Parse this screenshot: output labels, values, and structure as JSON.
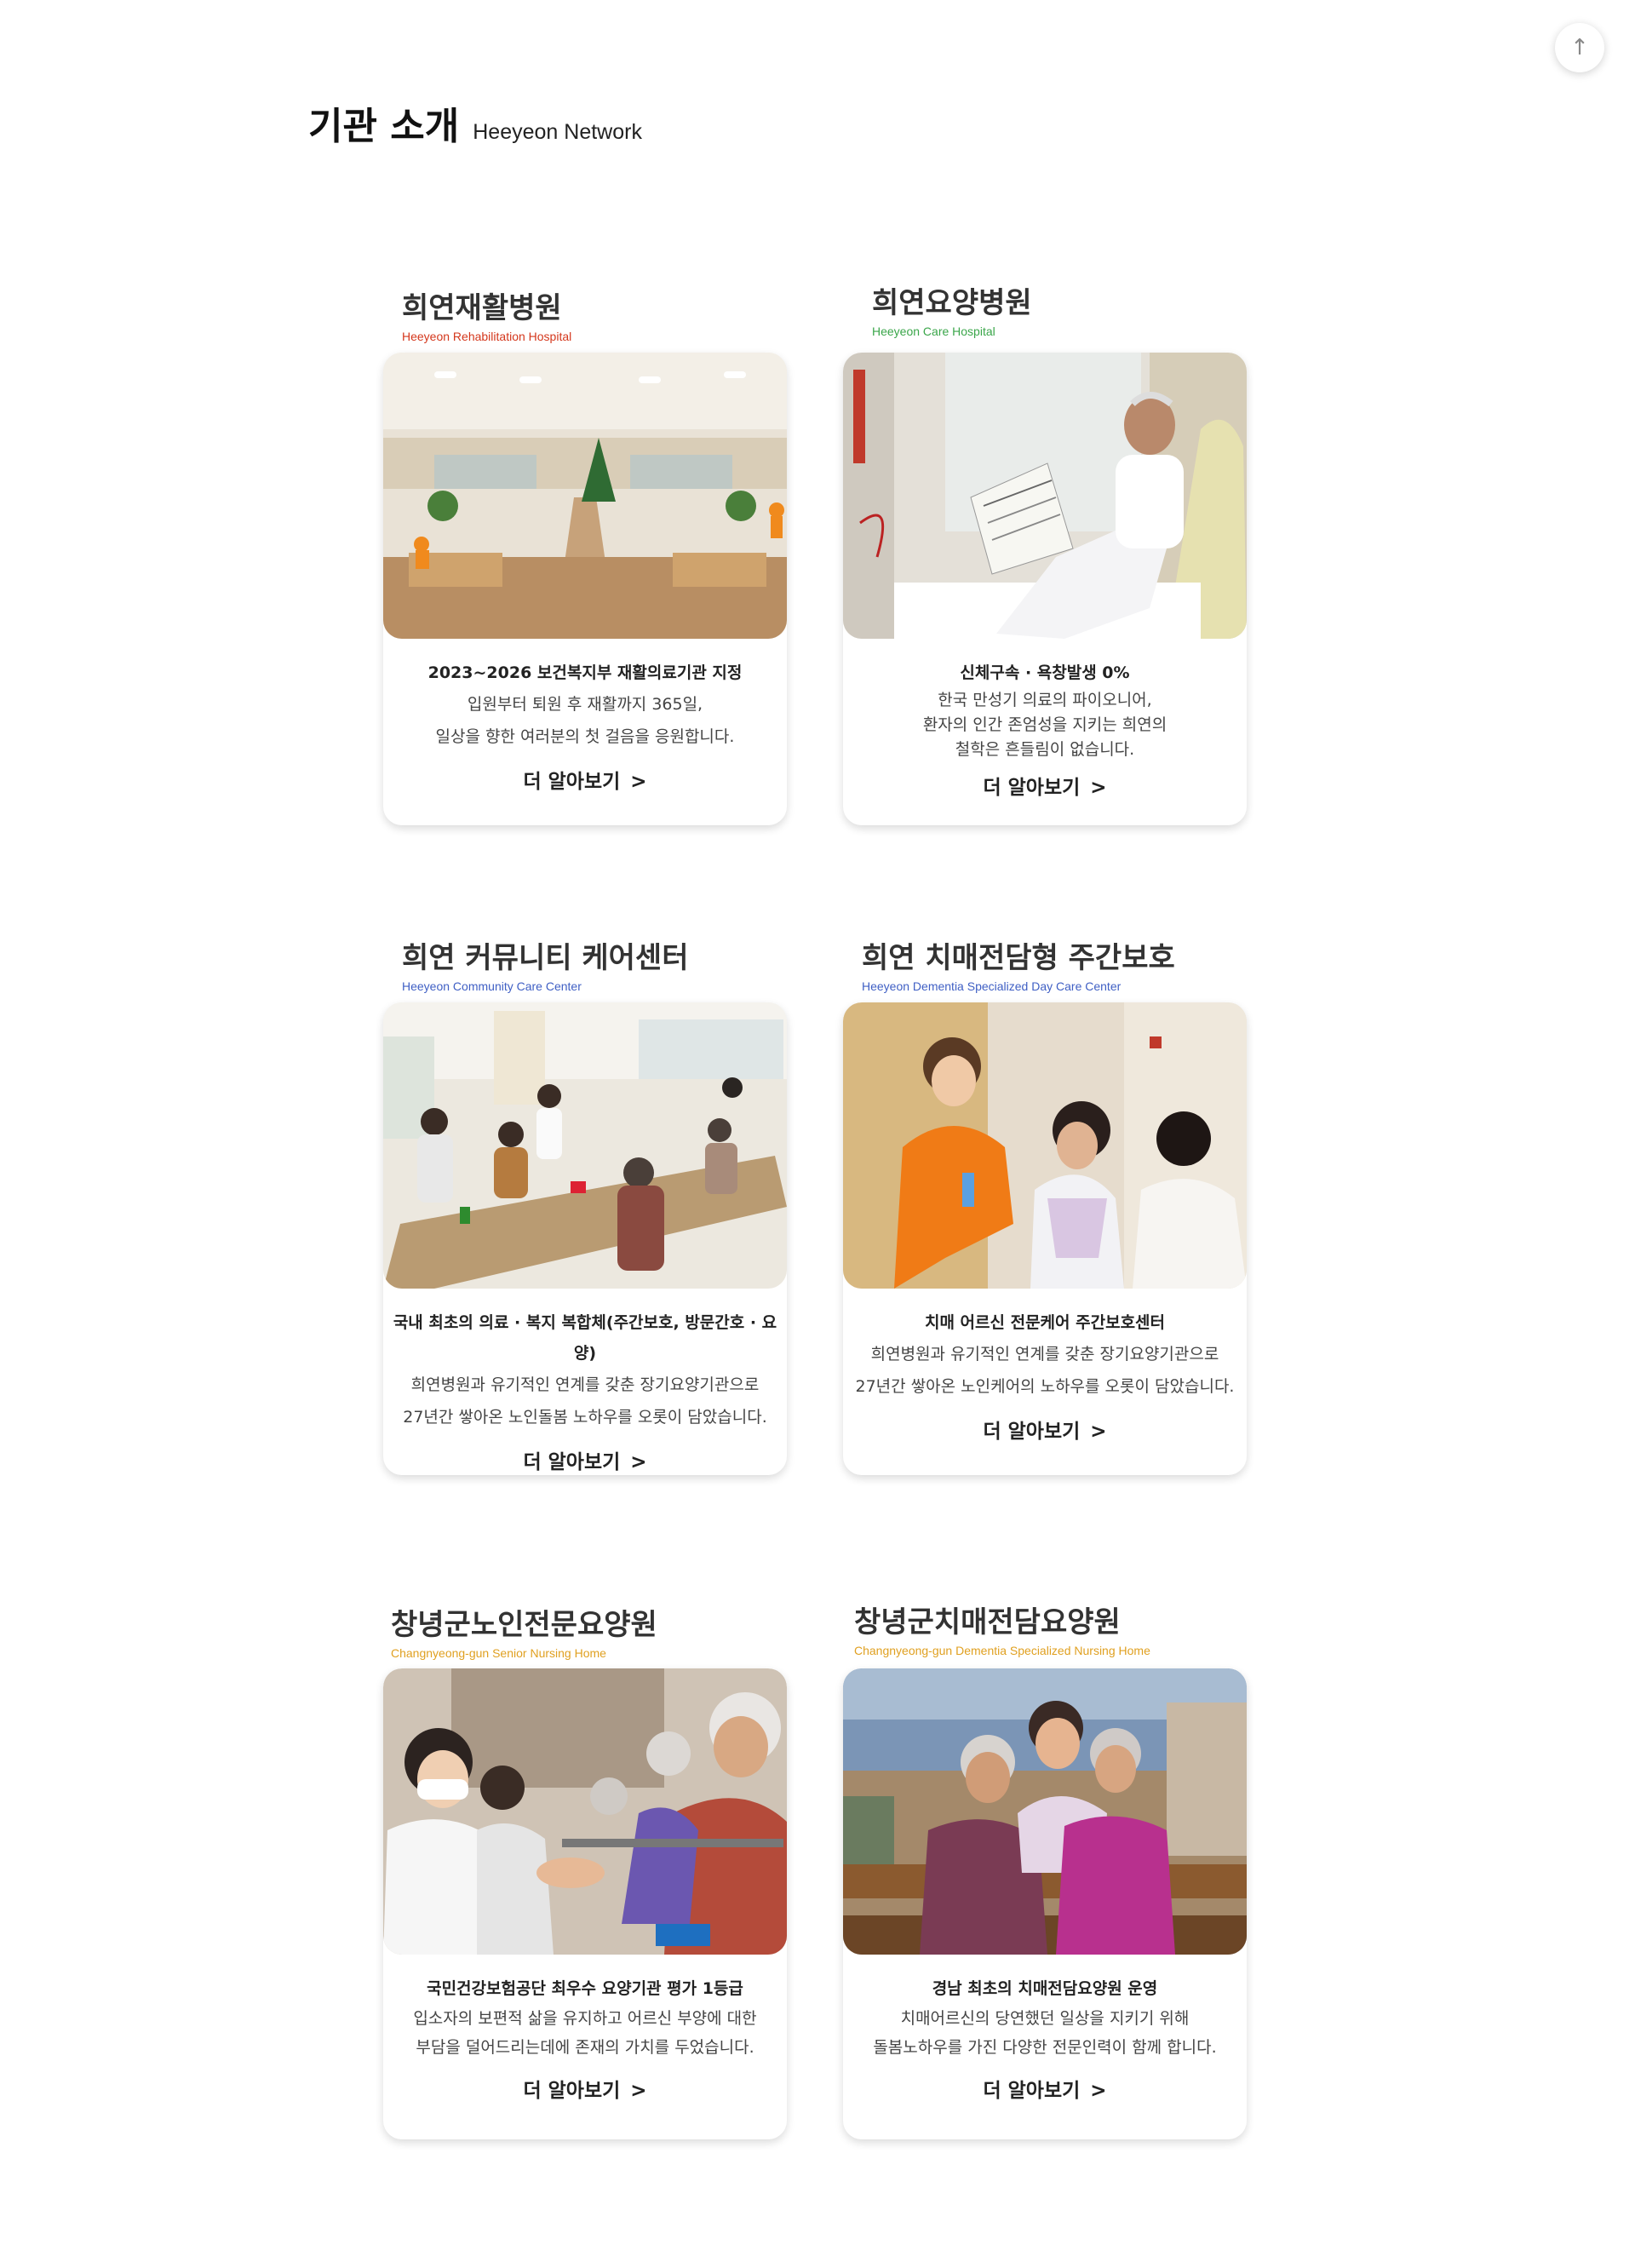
{
  "page": {
    "title_ko": "기관 소개",
    "title_en": "Heeyeon Network",
    "top_button_icon": "arrow-up-icon"
  },
  "institutions": [
    {
      "name_ko": "희연재활병원",
      "name_en": "Heeyeon Rehabilitation Hospital",
      "en_color": "#d4371c",
      "headline": "2023~2026 보건복지부 재활의료기관 지정",
      "lines": [
        "입원부터 퇴원 후 재활까지 365일,",
        "일상을 향한 여러분의 첫 걸음을 응원합니다."
      ],
      "more": "더 알아보기",
      "chev": ">"
    },
    {
      "name_ko": "희연요양병원",
      "name_en": "Heeyeon Care Hospital",
      "en_color": "#3aa64a",
      "headline": "신체구속 · 욕창발생 0%",
      "lines": [
        "한국 만성기 의료의 파이오니어,",
        "환자의 인간 존엄성을 지키는 희연의",
        "철학은 흔들림이 없습니다."
      ],
      "more": "더 알아보기",
      "chev": ">"
    },
    {
      "name_ko": "희연 커뮤니티 케어센터",
      "name_en": "Heeyeon Community Care Center",
      "en_color": "#3f5fc4",
      "headline": "국내 최초의 의료 · 복지 복합체(주간보호, 방문간호 · 요양)",
      "lines": [
        "희연병원과 유기적인 연계를 갖춘 장기요양기관으로",
        "27년간 쌓아온 노인돌봄 노하우를 오롯이 담았습니다."
      ],
      "more": "더 알아보기",
      "chev": ">"
    },
    {
      "name_ko": "희연 치매전담형 주간보호",
      "name_en": "Heeyeon Dementia Specialized Day Care Center",
      "en_color": "#3f5fc4",
      "headline": "치매 어르신 전문케어 주간보호센터",
      "lines": [
        "희연병원과 유기적인 연계를 갖춘 장기요양기관으로",
        "27년간 쌓아온 노인케어의 노하우를 오롯이 담았습니다."
      ],
      "more": "더 알아보기",
      "chev": ">"
    },
    {
      "name_ko": "창녕군노인전문요양원",
      "name_en": "Changnyeong-gun Senior Nursing Home",
      "en_color": "#e0a020",
      "headline": "국민건강보험공단 최우수 요양기관 평가 1등급",
      "lines": [
        "입소자의 보편적 삶을 유지하고 어르신 부양에 대한",
        "부담을 덜어드리는데에 존재의 가치를 두었습니다."
      ],
      "more": "더 알아보기",
      "chev": ">"
    },
    {
      "name_ko": "창녕군치매전담요양원",
      "name_en": "Changnyeong-gun Dementia Specialized Nursing Home",
      "en_color": "#e0a020",
      "headline": "경남 최초의 치매전담요양원 운영",
      "lines": [
        "치매어르신의 당연했던 일상을 지키기 위해",
        "돌봄노하우를 가진 다양한 전문인력이 함께 합니다."
      ],
      "more": "더 알아보기",
      "chev": ">"
    }
  ]
}
